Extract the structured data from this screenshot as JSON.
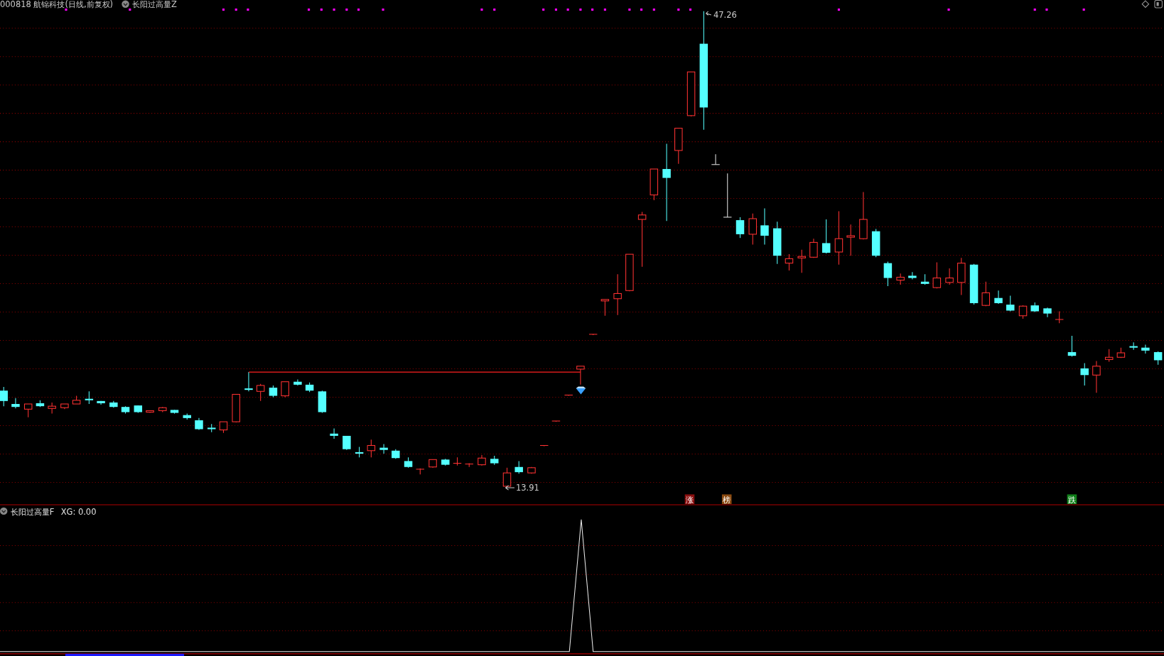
{
  "header": {
    "title": "000818 航锦科技(日线,前复权)",
    "indicator": "长阳过高量Z"
  },
  "price_labels": {
    "high": "47.26",
    "low": "13.91"
  },
  "markers": [
    {
      "text": "涨",
      "color": "#8b1010"
    },
    {
      "text": "榜",
      "color": "#8b4a10"
    },
    {
      "text": "跌",
      "color": "#10801a"
    }
  ],
  "indicator_panel": {
    "title": "长阳过高量F",
    "reading": "XG: 0.00"
  }
}
